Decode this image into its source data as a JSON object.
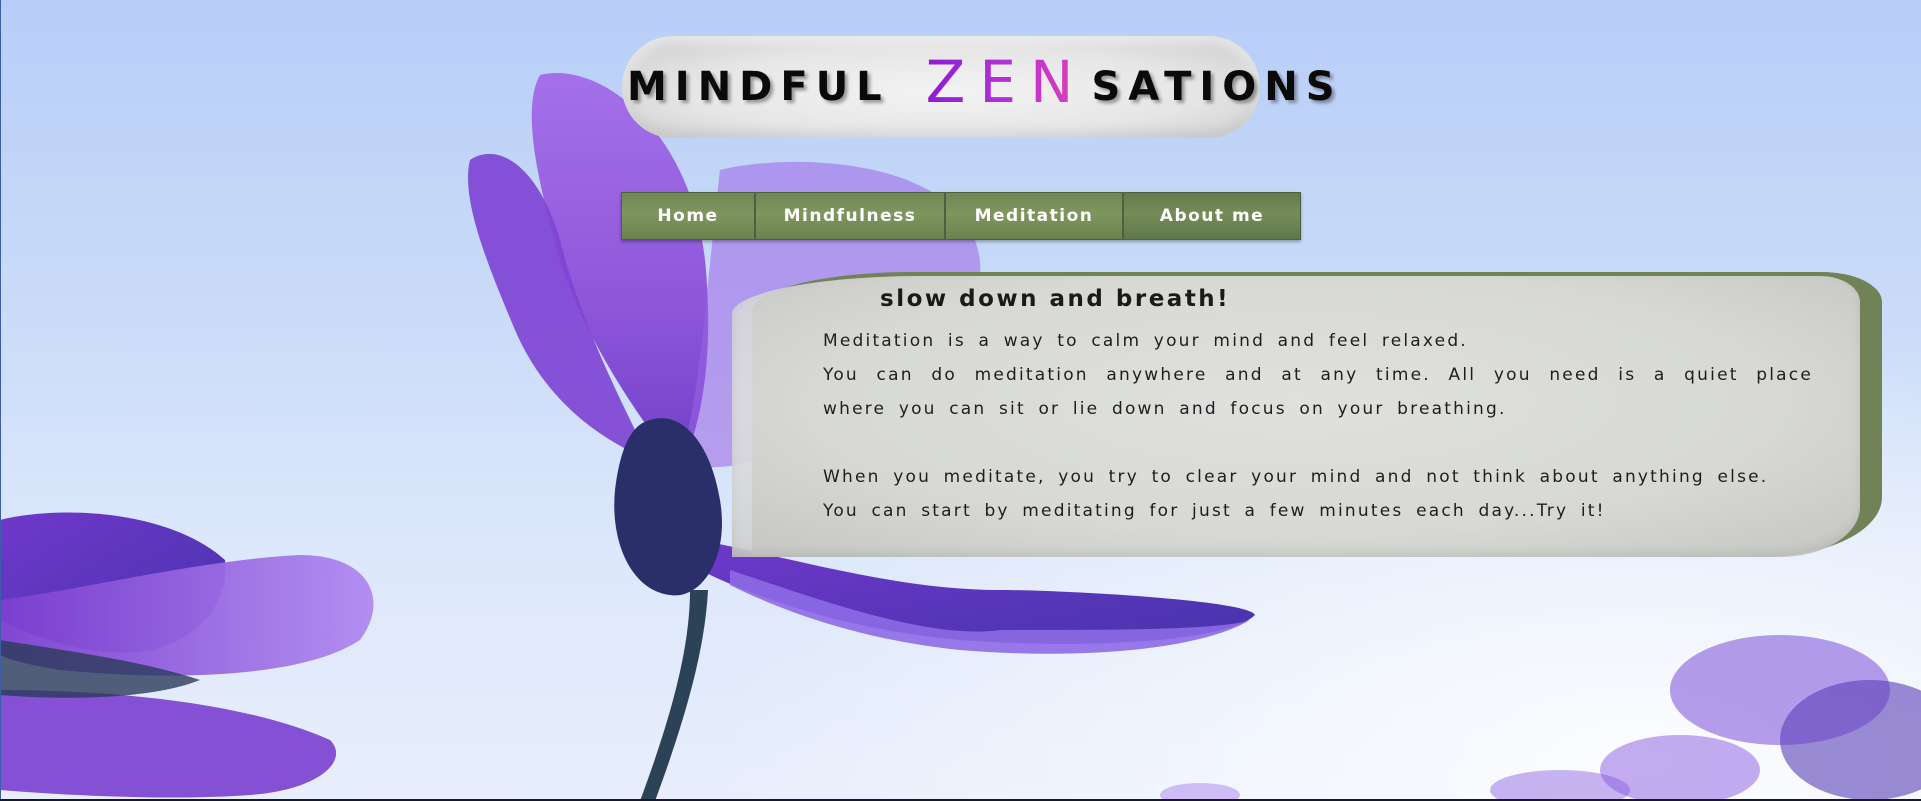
{
  "header": {
    "title_part1": "MINDFUL",
    "title_part2": "ZEN",
    "title_part3": "SATIONS"
  },
  "nav": {
    "items": [
      {
        "label": "Home"
      },
      {
        "label": "Mindfulness"
      },
      {
        "label": "Meditation"
      },
      {
        "label": "About me"
      }
    ]
  },
  "content": {
    "heading": "slow down and breath!",
    "line1": "Meditation is a way to calm your mind and feel relaxed.",
    "line2": "You can do meditation anywhere and at any time. All you need is a quiet place where you can sit or lie down and focus on your breathing.",
    "line3": "When you meditate, you try to clear your mind and not think about anything else.",
    "line4": "You can start by meditating for just a few minutes each day...Try it!"
  },
  "colors": {
    "nav_green": "#7a9160",
    "card_shadow_green": "#718257",
    "zen_gradient_start": "#8e1bd4",
    "zen_gradient_end": "#e040b8",
    "flower_purple": "#9c5ce0"
  },
  "background": {
    "image": "purple-cosmos-flower-sky"
  }
}
